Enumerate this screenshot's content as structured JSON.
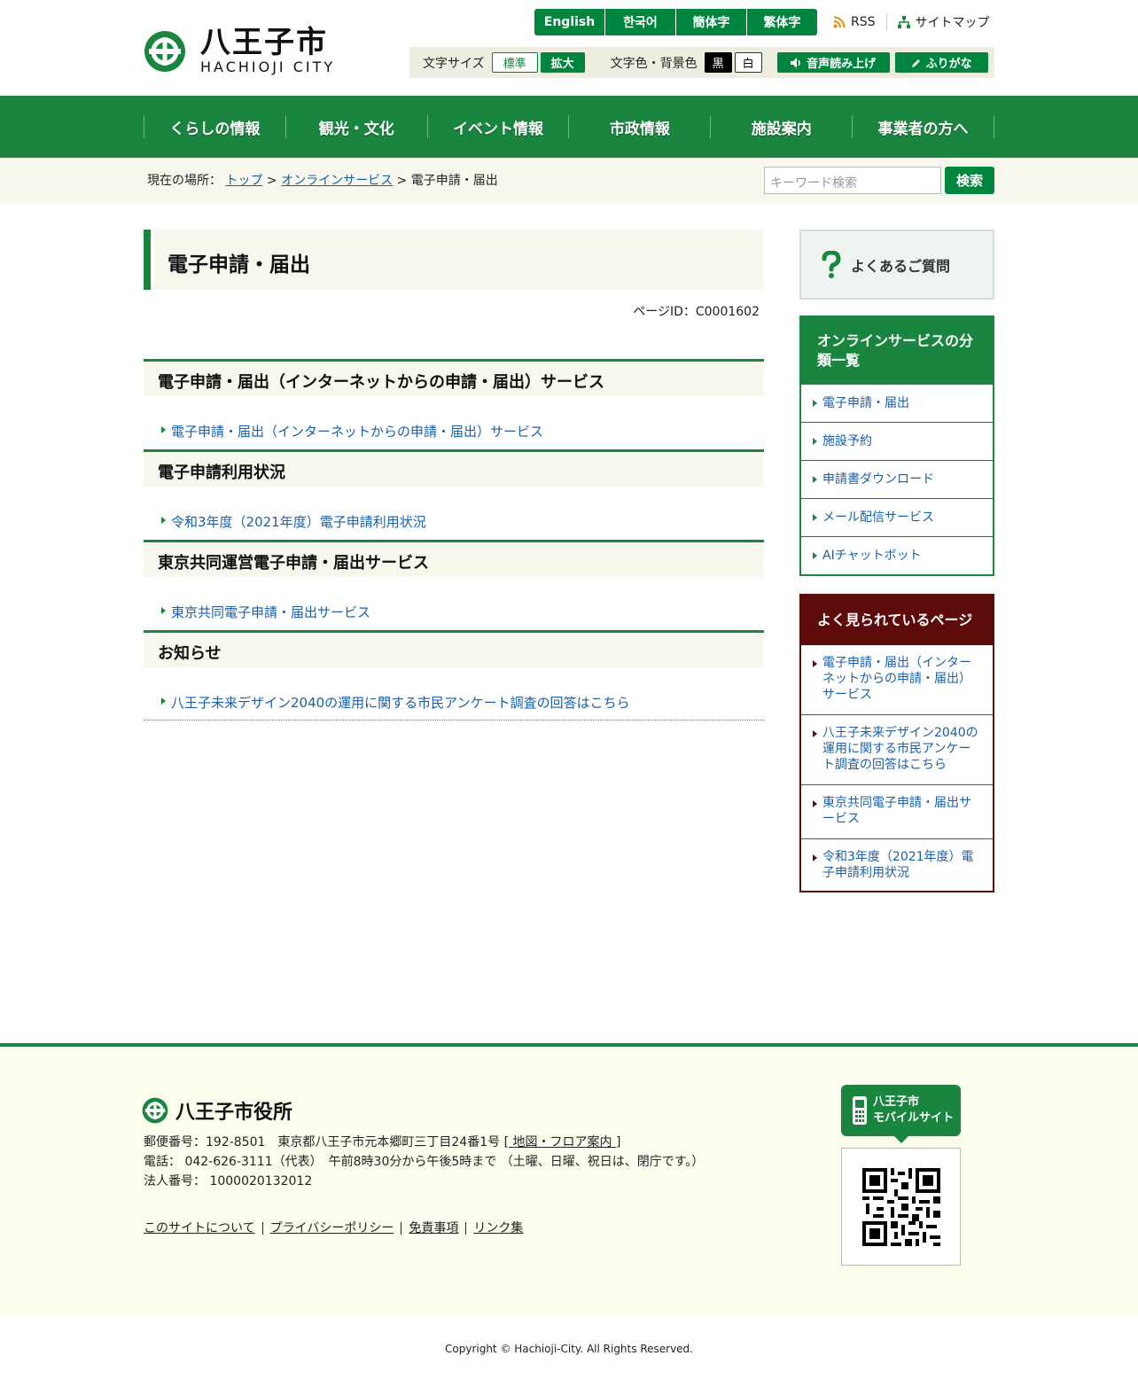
{
  "header": {
    "logo_jp": "八王子市",
    "logo_en": "HACHIOJI CITY",
    "languages": [
      "English",
      "한국어",
      "簡体字",
      "繁体字"
    ],
    "rss": "RSS",
    "sitemap": "サイトマップ",
    "text_size_label": "文字サイズ",
    "text_size_standard": "標準",
    "text_size_large": "拡大",
    "color_label": "文字色・背景色",
    "color_black": "黒",
    "color_white": "白",
    "speech": "音声読み上げ",
    "furigana": "ふりがな"
  },
  "nav": [
    "くらしの情報",
    "観光・文化",
    "イベント情報",
    "市政情報",
    "施設案内",
    "事業者の方へ"
  ],
  "breadcrumb": {
    "label": "現在の場所：",
    "top": "トップ",
    "online": "オンラインサービス",
    "current": "電子申請・届出",
    "sep": ">"
  },
  "search": {
    "placeholder": "キーワード検索",
    "button": "検索"
  },
  "main": {
    "title": "電子申請・届出",
    "page_id": "ページID：C0001602",
    "sections": [
      {
        "heading": "電子申請・届出（インターネットからの申請・届出）サービス",
        "link": "電子申請・届出（インターネットからの申請・届出）サービス"
      },
      {
        "heading": "電子申請利用状況",
        "link": "令和3年度（2021年度）電子申請利用状況"
      },
      {
        "heading": "東京共同運営電子申請・届出サービス",
        "link": "東京共同電子申請・届出サービス"
      },
      {
        "heading": "お知らせ",
        "link": "八王子未来デザイン2040の運用に関する市民アンケート調査の回答はこちら"
      }
    ]
  },
  "side": {
    "faq": "よくあるご質問",
    "category_title": "オンラインサービスの分類一覧",
    "categories": [
      "電子申請・届出",
      "施設予約",
      "申請書ダウンロード",
      "メール配信サービス",
      "AIチャットボット"
    ],
    "popular_title": "よく見られているページ",
    "popular": [
      "電子申請・届出（インターネットからの申請・届出）サービス",
      "八王子未来デザイン2040の運用に関する市民アンケート調査の回答はこちら",
      "東京共同電子申請・届出サービス",
      "令和3年度（2021年度）電子申請利用状況"
    ]
  },
  "footer": {
    "org": "八王子市役所",
    "address": "郵便番号：192-8501　東京都八王子市元本郷町三丁目24番1号",
    "map_link": "[ 地図・フロア案内 ]",
    "phone": "電話： 042-626-3111（代表）　午前8時30分から午後5時まで （土曜、日曜、祝日は、閉庁です。）",
    "corp_no": "法人番号： 1000020132012",
    "links": [
      "このサイトについて",
      "プライバシーポリシー",
      "免責事項",
      "リンク集"
    ],
    "mobile_line1": "八王子市",
    "mobile_line2": "モバイルサイト",
    "copyright": "Copyright © Hachioji-City. All Rights Reserved."
  },
  "colors": {
    "brand_green": "#19853f",
    "popular_red": "#5e0b0b",
    "link_blue": "#1a5fa8"
  }
}
